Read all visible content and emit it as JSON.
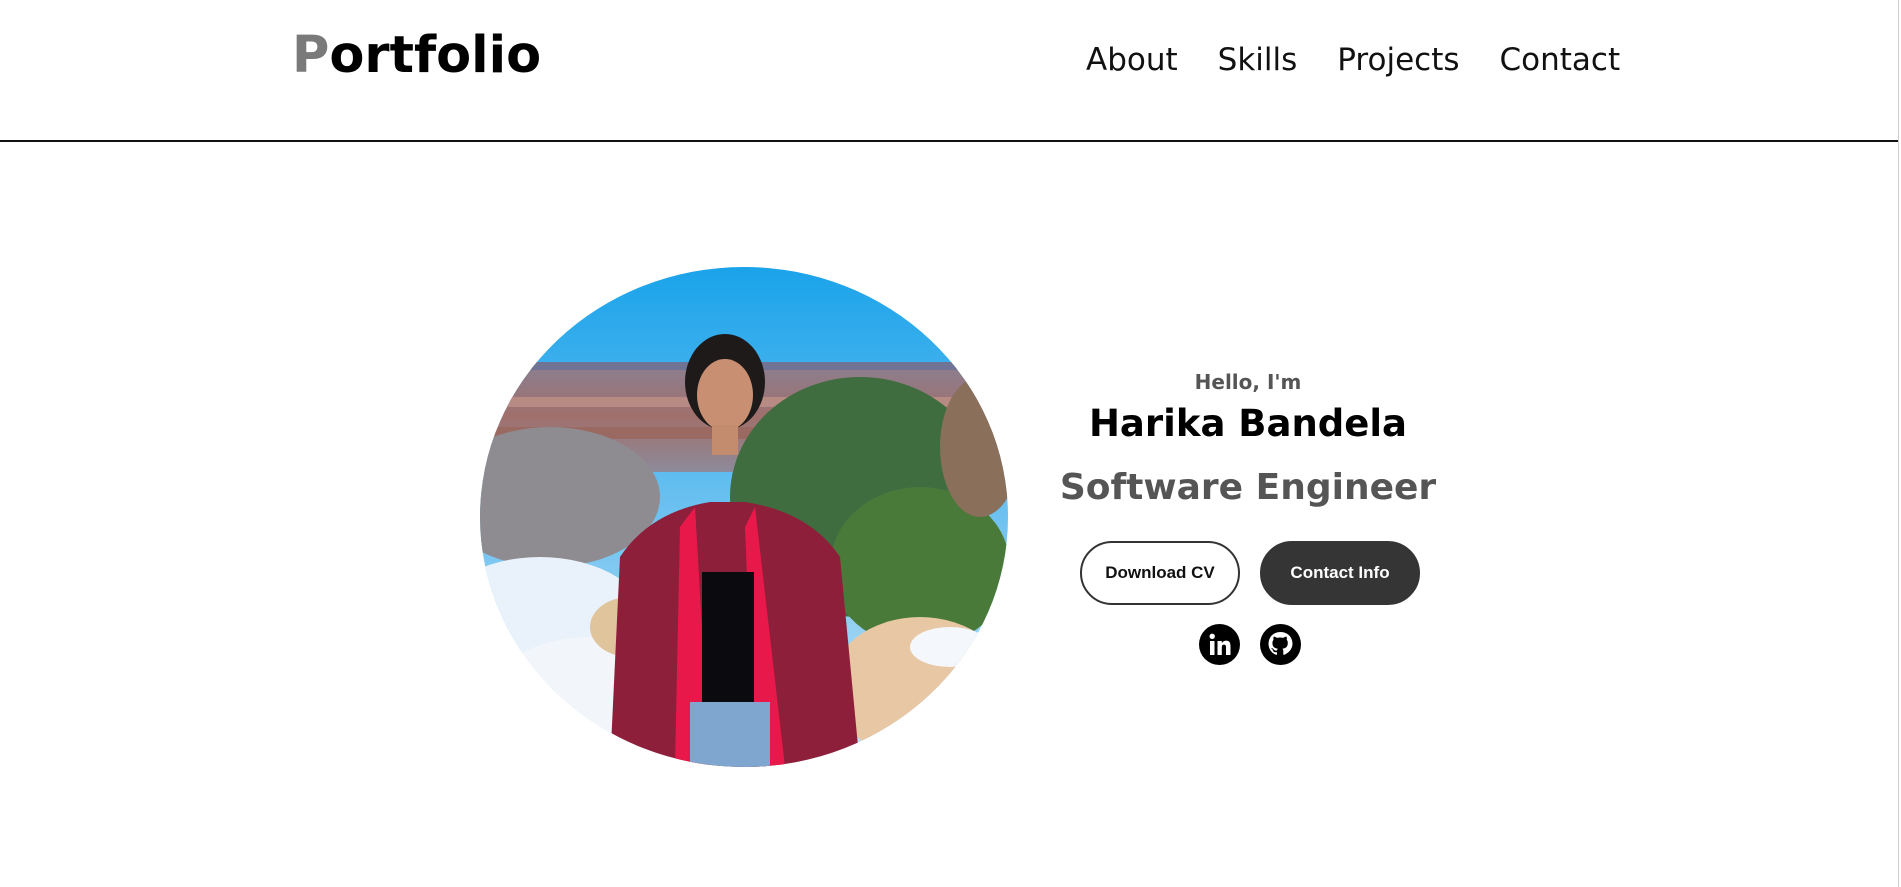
{
  "header": {
    "logo_first": "P",
    "logo_rest": "ortfolio",
    "nav": [
      "About",
      "Skills",
      "Projects",
      "Contact"
    ]
  },
  "hero": {
    "greeting": "Hello, I'm",
    "name": "Harika Bandela",
    "title": "Software Engineer",
    "buttons": {
      "download": "Download CV",
      "contact": "Contact Info"
    },
    "socials": [
      "linkedin-icon",
      "github-icon"
    ]
  },
  "colors": {
    "logo_accent": "#7a7a7a",
    "dark_button": "#353535",
    "subtitle": "#555555"
  }
}
